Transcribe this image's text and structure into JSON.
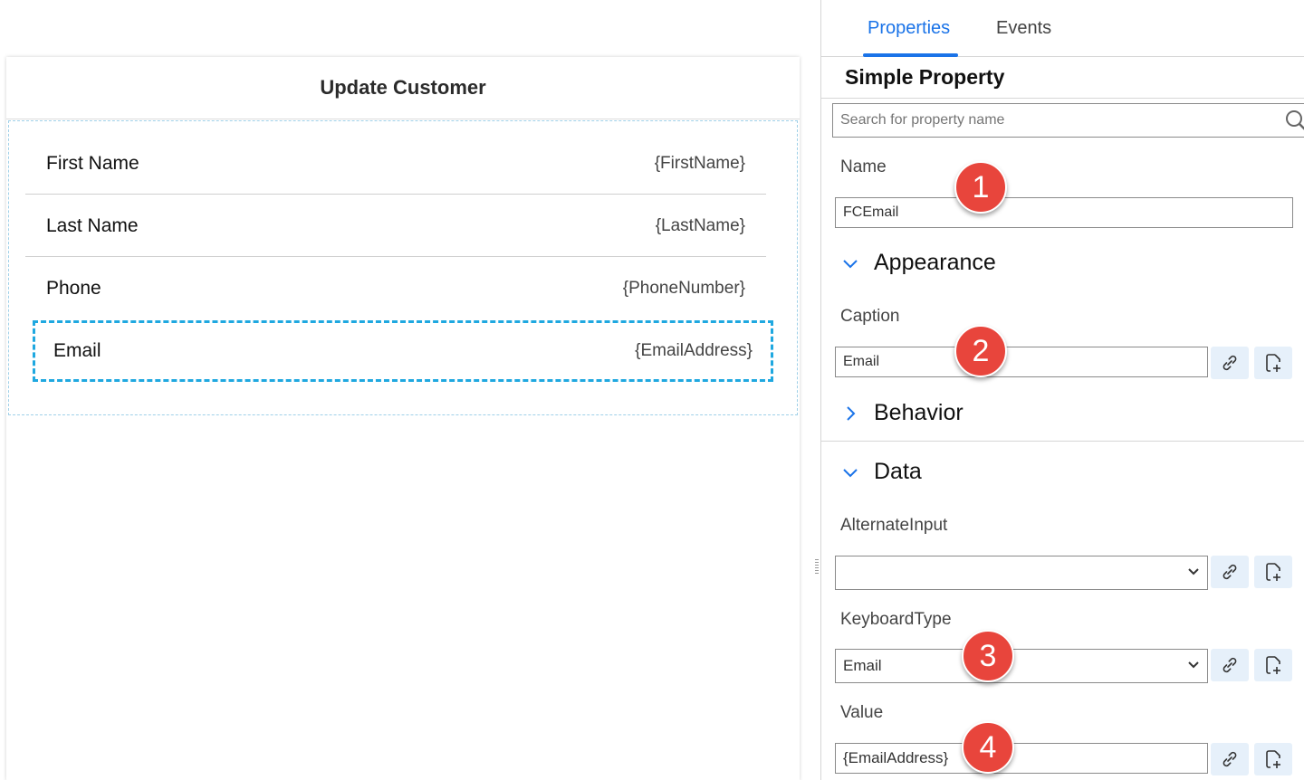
{
  "form": {
    "title": "Update Customer",
    "rows": [
      {
        "label": "First Name",
        "value": "{FirstName}"
      },
      {
        "label": "Last Name",
        "value": "{LastName}"
      },
      {
        "label": "Phone",
        "value": "{PhoneNumber}"
      },
      {
        "label": "Email",
        "value": "{EmailAddress}"
      }
    ]
  },
  "panel": {
    "tabs": [
      "Properties",
      "Events"
    ],
    "active_tab": "Properties",
    "title": "Simple Property",
    "search_placeholder": "Search for property name",
    "name_label": "Name",
    "name_value": "FCEmail",
    "sections": {
      "appearance": "Appearance",
      "behavior": "Behavior",
      "data": "Data"
    },
    "caption_label": "Caption",
    "caption_value": "Email",
    "alternate_input_label": "AlternateInput",
    "alternate_input_value": "",
    "keyboard_type_label": "KeyboardType",
    "keyboard_type_value": "Email",
    "value_label": "Value",
    "value_value": "{EmailAddress}"
  },
  "callouts": [
    "1",
    "2",
    "3",
    "4"
  ],
  "colors": {
    "accent": "#1a73e8",
    "callout": "#e8453c",
    "selection": "#1fa8e0",
    "icon_button_bg": "#e6f0fa"
  }
}
